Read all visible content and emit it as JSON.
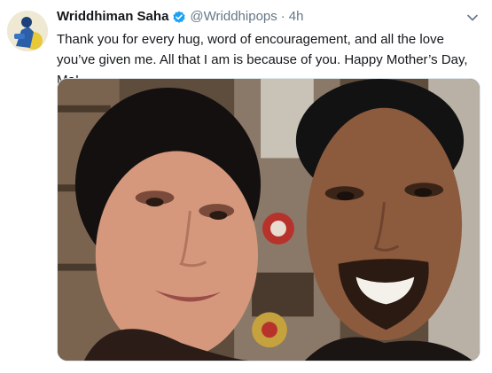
{
  "tweet": {
    "author_name": "Wriddhiman Saha",
    "handle": "@Wriddhipops",
    "separator": "·",
    "timestamp": "4h",
    "text": "Thank you for every hug, word of encouragement, and all the love you’ve given me. All that I am is because of you. Happy Mother’s Day, Ma!",
    "verified": true
  },
  "icons": {
    "verified": "verified-badge-icon",
    "menu": "chevron-down-icon"
  },
  "colors": {
    "text_primary": "#14171a",
    "text_secondary": "#657786",
    "verified_blue": "#1da1f2",
    "border": "#e1e8ed"
  }
}
